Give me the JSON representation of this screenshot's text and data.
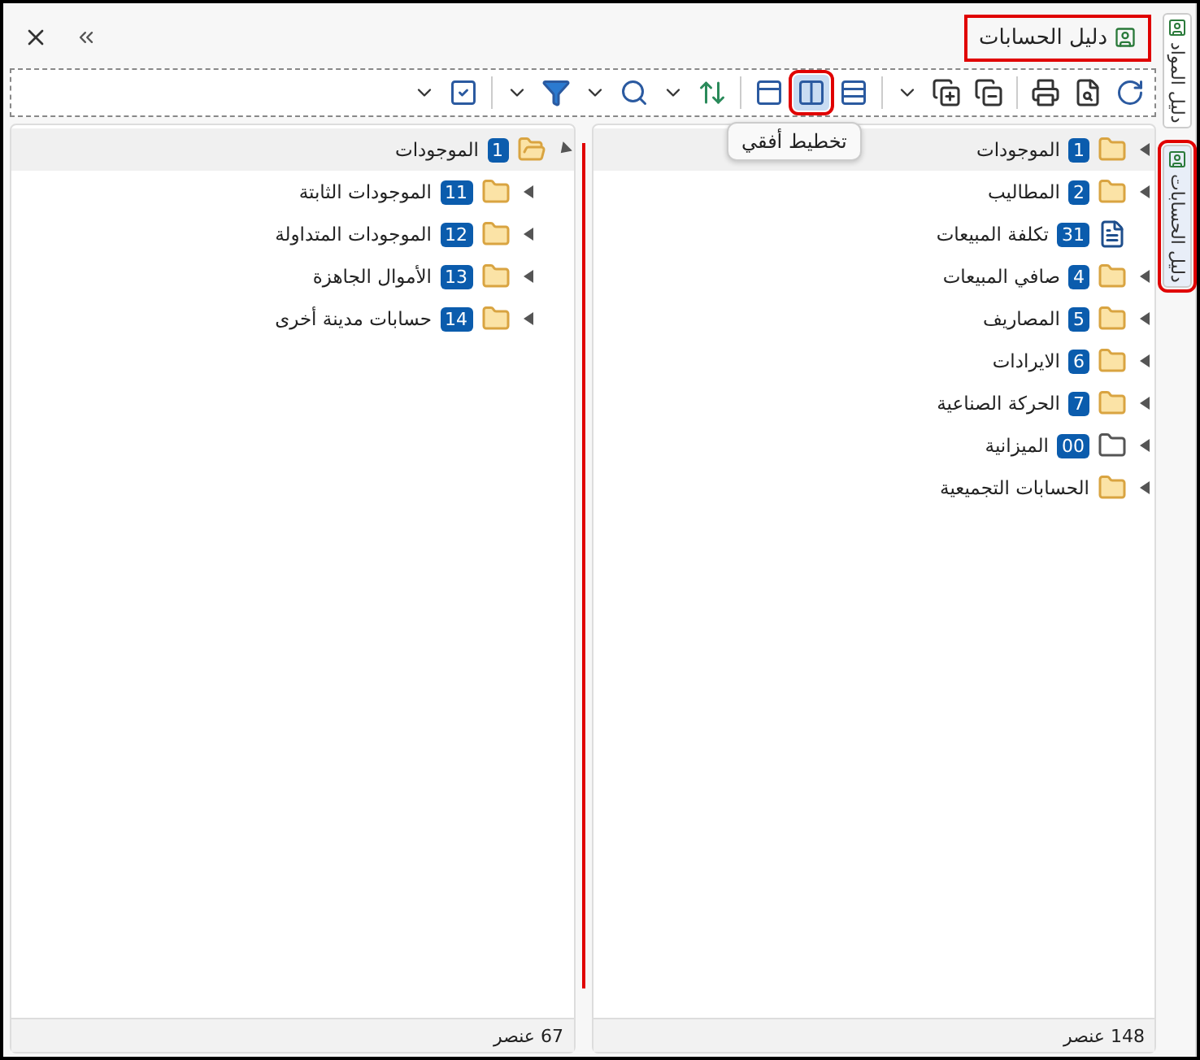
{
  "side_tabs": [
    {
      "label": "دليل المواد",
      "selected": false,
      "highlighted": false
    },
    {
      "label": "دليل الحسابات",
      "selected": true,
      "highlighted": true
    }
  ],
  "window": {
    "title": "دليل الحسابات",
    "title_highlighted": true
  },
  "toolbar": {
    "layouts": [
      {
        "kind": "rows",
        "selected": false,
        "highlighted": false
      },
      {
        "kind": "columns",
        "selected": true,
        "highlighted": true
      },
      {
        "kind": "single",
        "selected": false,
        "highlighted": false
      }
    ],
    "tooltip": "تخطيط أفقي"
  },
  "right_pane": {
    "rows": [
      {
        "code": "1",
        "name": "الموجودات",
        "kind": "folder",
        "expandable": true,
        "selected": true
      },
      {
        "code": "2",
        "name": "المطاليب",
        "kind": "folder",
        "expandable": true,
        "selected": false
      },
      {
        "code": "31",
        "name": "تكلفة المبيعات",
        "kind": "document",
        "expandable": false,
        "selected": false
      },
      {
        "code": "4",
        "name": "صافي المبيعات",
        "kind": "folder",
        "expandable": true,
        "selected": false
      },
      {
        "code": "5",
        "name": "المصاريف",
        "kind": "folder",
        "expandable": true,
        "selected": false
      },
      {
        "code": "6",
        "name": "الايرادات",
        "kind": "folder",
        "expandable": true,
        "selected": false
      },
      {
        "code": "7",
        "name": "الحركة الصناعية",
        "kind": "folder",
        "expandable": true,
        "selected": false
      },
      {
        "code": "00",
        "name": "الميزانية",
        "kind": "folder-empty",
        "expandable": true,
        "selected": false
      },
      {
        "name": "الحسابات التجميعية",
        "kind": "folder",
        "expandable": true,
        "selected": false
      }
    ],
    "status": "148 عنصر"
  },
  "left_pane": {
    "rows": [
      {
        "code": "1",
        "name": "الموجودات",
        "kind": "folder-open",
        "expandable": true,
        "expanded": true,
        "selected": true,
        "children": [
          {
            "code": "11",
            "name": "الموجودات الثابتة",
            "kind": "folder",
            "expandable": true,
            "expanded": false,
            "selected": false
          },
          {
            "code": "12",
            "name": "الموجودات المتداولة",
            "kind": "folder",
            "expandable": true,
            "expanded": false,
            "selected": false
          },
          {
            "code": "13",
            "name": "الأموال الجاهزة",
            "kind": "folder",
            "expandable": true,
            "expanded": false,
            "selected": false
          },
          {
            "code": "14",
            "name": "حسابات مدينة أخرى",
            "kind": "folder",
            "expandable": true,
            "expanded": false,
            "selected": false
          }
        ]
      }
    ],
    "status": "67 عنصر"
  }
}
